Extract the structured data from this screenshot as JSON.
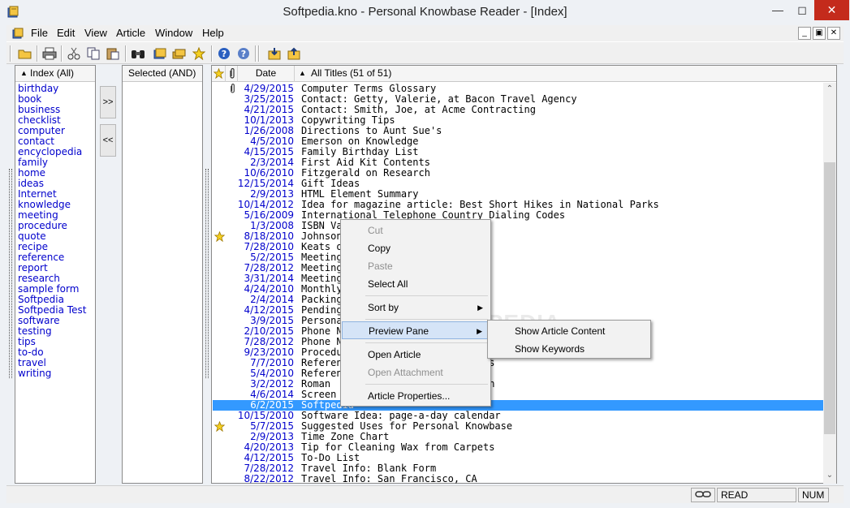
{
  "window": {
    "title": "Softpedia.kno - Personal Knowbase Reader - [Index]"
  },
  "menubar": {
    "items": [
      "File",
      "Edit",
      "View",
      "Article",
      "Window",
      "Help"
    ]
  },
  "index_panel": {
    "header": "Index (All)",
    "items": [
      "birthday",
      "book",
      "business",
      "checklist",
      "computer",
      "contact",
      "encyclopedia",
      "family",
      "home",
      "ideas",
      "Internet",
      "knowledge",
      "meeting",
      "procedure",
      "quote",
      "recipe",
      "reference",
      "report",
      "research",
      "sample form",
      "Softpedia",
      "Softpedia Test",
      "software",
      "testing",
      "tips",
      "to-do",
      "travel",
      "writing"
    ]
  },
  "move_buttons": {
    "add": ">>",
    "remove": "<<"
  },
  "selected_panel": {
    "header": "Selected (AND)"
  },
  "articles_panel": {
    "date_header": "Date",
    "titles_header": "All Titles (51 of 51)",
    "rows": [
      {
        "date": "4/29/2015",
        "title": "Computer Terms Glossary",
        "clip": true,
        "star": false
      },
      {
        "date": "3/25/2015",
        "title": "Contact: Getty, Valerie, at Bacon Travel Agency",
        "clip": false,
        "star": false
      },
      {
        "date": "4/21/2015",
        "title": "Contact: Smith, Joe, at Acme Contracting",
        "clip": false,
        "star": false
      },
      {
        "date": "10/1/2013",
        "title": "Copywriting Tips",
        "clip": false,
        "star": false
      },
      {
        "date": "1/26/2008",
        "title": "Directions to Aunt Sue's",
        "clip": false,
        "star": false
      },
      {
        "date": "4/5/2010",
        "title": "Emerson on Knowledge",
        "clip": false,
        "star": false
      },
      {
        "date": "4/15/2015",
        "title": "Family Birthday List",
        "clip": false,
        "star": false
      },
      {
        "date": "2/3/2014",
        "title": "First Aid Kit Contents",
        "clip": false,
        "star": false
      },
      {
        "date": "10/6/2010",
        "title": "Fitzgerald on Research",
        "clip": false,
        "star": false
      },
      {
        "date": "12/15/2014",
        "title": "Gift Ideas",
        "clip": false,
        "star": false
      },
      {
        "date": "2/9/2013",
        "title": "HTML Element Summary",
        "clip": false,
        "star": false
      },
      {
        "date": "10/14/2012",
        "title": "Idea for magazine article: Best Short Hikes in National Parks",
        "clip": false,
        "star": false
      },
      {
        "date": "5/16/2009",
        "title": "International Telephone Country Dialing Codes",
        "clip": false,
        "star": false
      },
      {
        "date": "1/3/2008",
        "title": "ISBN Va",
        "clip": false,
        "star": false
      },
      {
        "date": "8/18/2010",
        "title": "Johnson",
        "clip": false,
        "star": true
      },
      {
        "date": "7/28/2010",
        "title": "Keats or",
        "clip": false,
        "star": false
      },
      {
        "date": "5/2/2015",
        "title": "Meeting",
        "clip": false,
        "star": false
      },
      {
        "date": "7/28/2012",
        "title": "Meeting",
        "clip": false,
        "star": false
      },
      {
        "date": "3/31/2014",
        "title": "Meeting",
        "clip": false,
        "star": false
      },
      {
        "date": "4/24/2010",
        "title": "Monthly",
        "clip": false,
        "star": false
      },
      {
        "date": "2/4/2014",
        "title": "Packing",
        "clip": false,
        "star": false
      },
      {
        "date": "4/12/2015",
        "title": "Pending",
        "clip": false,
        "star": false
      },
      {
        "date": "3/9/2015",
        "title": "Persona",
        "clip": false,
        "star": false
      },
      {
        "date": "2/10/2015",
        "title": "Phone N",
        "clip": false,
        "star": false
      },
      {
        "date": "7/28/2012",
        "title": "Phone N",
        "clip": false,
        "star": false
      },
      {
        "date": "9/23/2010",
        "title": "Procedu",
        "clip": false,
        "star": false
      },
      {
        "date": "7/7/2010",
        "title": "Referen                     esses",
        "clip": false,
        "star": false
      },
      {
        "date": "5/4/2010",
        "title": "Referen",
        "clip": false,
        "star": false
      },
      {
        "date": "3/2/2012",
        "title": "Roman                       ngton",
        "clip": false,
        "star": false
      },
      {
        "date": "4/6/2014",
        "title": "Screen",
        "clip": false,
        "star": false
      },
      {
        "date": "6/2/2015",
        "title": "Softpedia",
        "clip": false,
        "star": false,
        "selected": true
      },
      {
        "date": "10/15/2010",
        "title": "Software Idea: page-a-day calendar",
        "clip": false,
        "star": false
      },
      {
        "date": "5/7/2015",
        "title": "Suggested Uses for Personal Knowbase",
        "clip": false,
        "star": true
      },
      {
        "date": "2/9/2013",
        "title": "Time Zone Chart",
        "clip": false,
        "star": false
      },
      {
        "date": "4/20/2013",
        "title": "Tip for Cleaning Wax from Carpets",
        "clip": false,
        "star": false
      },
      {
        "date": "4/12/2015",
        "title": "To-Do List",
        "clip": false,
        "star": false
      },
      {
        "date": "7/28/2012",
        "title": "Travel Info: Blank Form",
        "clip": false,
        "star": false
      },
      {
        "date": "8/22/2012",
        "title": "Travel Info: San Francisco, CA",
        "clip": false,
        "star": false
      }
    ]
  },
  "context_menu": {
    "cut": "Cut",
    "copy": "Copy",
    "paste": "Paste",
    "select_all": "Select All",
    "sort_by": "Sort by",
    "preview_pane": "Preview Pane",
    "open_article": "Open Article",
    "open_attachment": "Open Attachment",
    "article_properties": "Article Properties..."
  },
  "submenu": {
    "show_article_content": "Show Article Content",
    "show_keywords": "Show Keywords"
  },
  "statusbar": {
    "read": "READ",
    "num": "NUM"
  },
  "watermark": "SOFTPEDIA",
  "colors": {
    "selection": "#3399ff",
    "link_blue": "#0000cc",
    "close_red": "#c42b1c",
    "menu_highlight": "#d5e4f7"
  }
}
